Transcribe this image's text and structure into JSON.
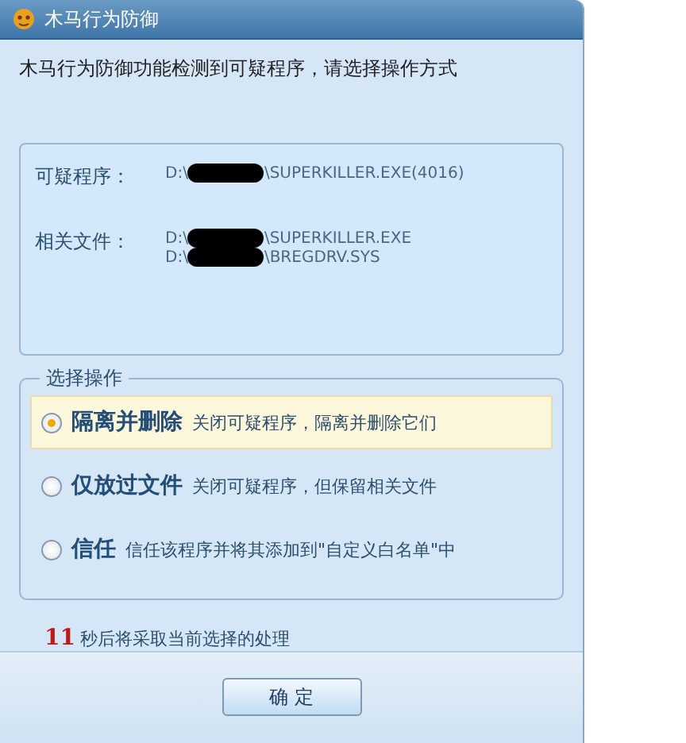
{
  "window": {
    "title": "木马行为防御"
  },
  "message": "木马行为防御功能检测到可疑程序，请选择操作方式",
  "details": [
    {
      "label": "可疑程序：",
      "paths": [
        {
          "prefix": "D:\\",
          "suffix": "\\SUPERKILLER.EXE(4016)"
        }
      ]
    },
    {
      "label": "相关文件：",
      "paths": [
        {
          "prefix": "D:\\",
          "suffix": "\\SUPERKILLER.EXE"
        },
        {
          "prefix": "D:\\",
          "suffix": "\\BREGDRV.SYS"
        }
      ]
    }
  ],
  "options_group": {
    "title": "选择操作",
    "options": [
      {
        "label": "隔离并删除",
        "description": "关闭可疑程序，隔离并删除它们",
        "selected": true
      },
      {
        "label": "仅放过文件",
        "description": "关闭可疑程序，但保留相关文件",
        "selected": false
      },
      {
        "label": "信任",
        "description": "信任该程序并将其添加到\"自定义白名单\"中",
        "selected": false
      }
    ]
  },
  "countdown": {
    "seconds": "11",
    "text": "秒后将采取当前选择的处理"
  },
  "buttons": [
    "确 定"
  ]
}
